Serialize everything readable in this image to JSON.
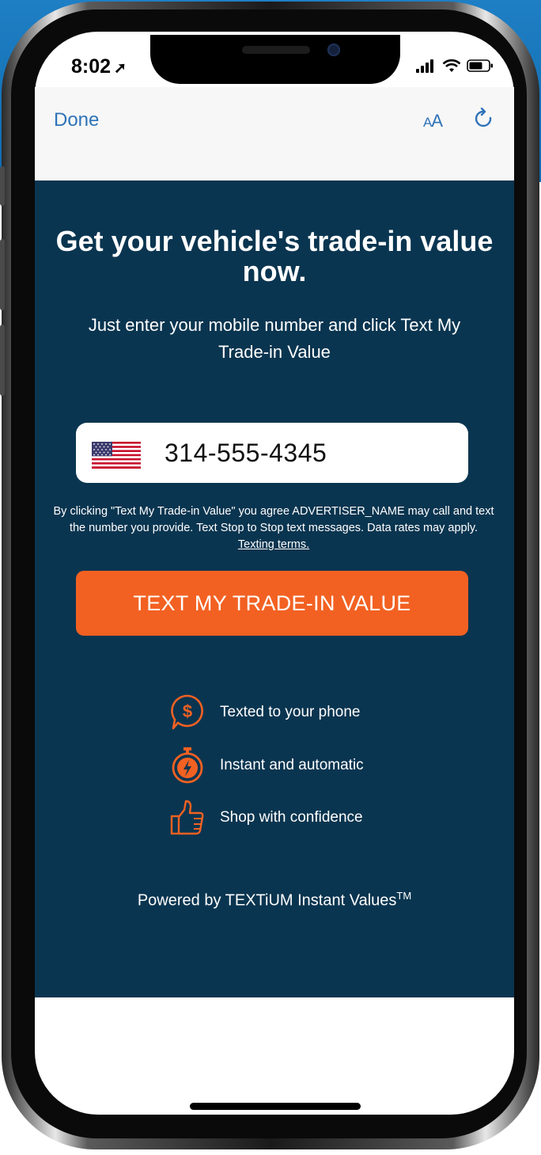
{
  "status_bar": {
    "time": "8:02"
  },
  "browser": {
    "done_label": "Done",
    "text_size_label": "A",
    "text_size_label_large": "A"
  },
  "content": {
    "headline": "Get your vehicle's trade-in value now.",
    "subheadline": "Just enter your mobile number and click Text My Trade-in Value",
    "phone_value": "314-555-4345",
    "disclaimer": "By clicking \"Text My Trade-in Value\" you agree ADVERTISER_NAME may call and text the number you provide. Text Stop to Stop text messages. Data rates may apply.",
    "terms_link": "Texting terms.",
    "cta_label": "TEXT MY TRADE-IN VALUE",
    "features": [
      {
        "icon": "dollar-chat-icon",
        "label": "Texted to your phone"
      },
      {
        "icon": "stopwatch-icon",
        "label": "Instant and automatic"
      },
      {
        "icon": "thumbs-up-icon",
        "label": "Shop with confidence"
      }
    ],
    "powered_by": "Powered by TEXTiUM Instant Values",
    "trademark": "TM"
  },
  "colors": {
    "panel_bg": "#0a3550",
    "accent_orange": "#f26122",
    "link_blue": "#2f73b8"
  }
}
